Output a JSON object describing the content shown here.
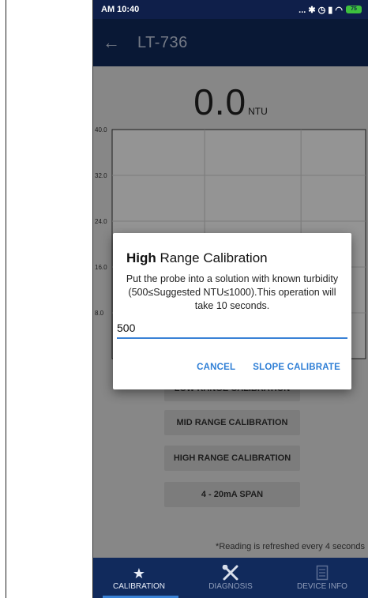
{
  "status": {
    "time": "AM 10:40",
    "icons": "... ✱ ◷ ▮ ◠",
    "battery": "75"
  },
  "appbar": {
    "back_icon": "arrow-left-icon",
    "title": "LT-736"
  },
  "reading": {
    "value": "0.0",
    "unit": "NTU"
  },
  "chart_data": {
    "type": "line",
    "title": "",
    "xlabel": "",
    "ylabel": "",
    "y_ticks": [
      "40.0",
      "32.0",
      "24.0",
      "16.0",
      "8.0"
    ],
    "ylim": [
      0,
      40
    ],
    "grid": true,
    "series": []
  },
  "buttons": {
    "low": "LOW RANGE CALIBRATION",
    "mid": "MID RANGE CALIBRATION",
    "high": "HIGH RANGE CALIBRATION",
    "span": "4 - 20mA SPAN"
  },
  "note": "*Reading is refreshed every 4 seconds",
  "dialog": {
    "title_a": "High",
    "title_b": "Range Calibration",
    "message": "Put the probe into a solution with known turbidity (500≤Suggested NTU≤1000).This operation will take 10 seconds.",
    "input_value": "500",
    "cancel": "CANCEL",
    "confirm": "SLOPE CALIBRATE"
  },
  "nav": [
    {
      "label": "CALIBRATION",
      "icon": "star-icon",
      "active": true
    },
    {
      "label": "DIAGNOSIS",
      "icon": "tools-icon",
      "active": false
    },
    {
      "label": "DEVICE INFO",
      "icon": "document-icon",
      "active": false
    }
  ],
  "colors": {
    "appbar": "#112a5c",
    "accent": "#3a82d6"
  }
}
